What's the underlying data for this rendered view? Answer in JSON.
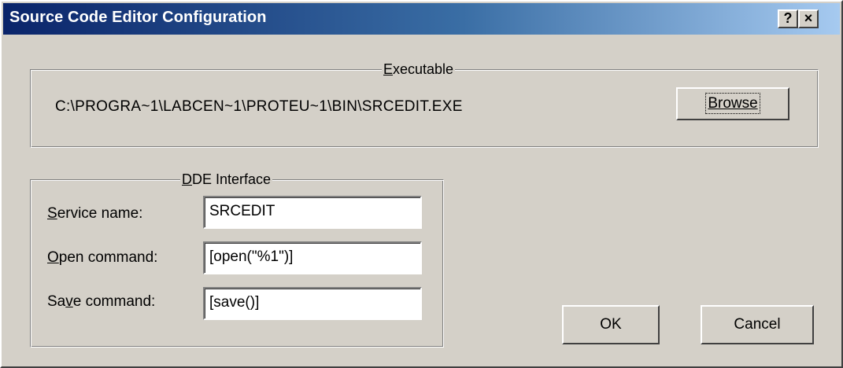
{
  "window": {
    "title": "Source Code Editor Configuration",
    "help_button": "?",
    "close_button": "×"
  },
  "executable": {
    "group_label_accel": "E",
    "group_label_rest": "xecutable",
    "path": "C:\\PROGRA~1\\LABCEN~1\\PROTEU~1\\BIN\\SRCEDIT.EXE",
    "browse_label": "Browse"
  },
  "dde": {
    "group_label_accel": "D",
    "group_label_rest": "DE Interface",
    "service": {
      "label_accel": "S",
      "label_rest": "ervice name:",
      "value": "SRCEDIT"
    },
    "open": {
      "label_accel": "O",
      "label_rest": "pen command:",
      "value": "[open(\"%1\")]"
    },
    "save": {
      "label_pre": "Sa",
      "label_accel": "v",
      "label_rest": "e command:",
      "value": "[save()]"
    }
  },
  "buttons": {
    "ok": "OK",
    "cancel": "Cancel"
  }
}
